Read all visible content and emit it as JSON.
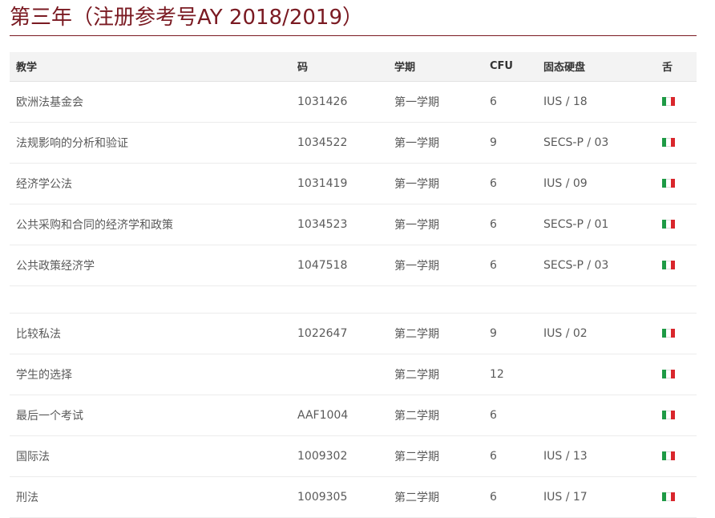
{
  "page": {
    "title": "第三年（注册参考号AY 2018/2019）"
  },
  "table": {
    "headers": {
      "course": "教学",
      "code": "码",
      "semester": "学期",
      "cfu": "CFU",
      "ssd": "固态硬盘",
      "language": "舌"
    },
    "semester1_rows": [
      {
        "course": "欧洲法基金会",
        "code": "1031426",
        "semester": "第一学期",
        "cfu": "6",
        "ssd": "IUS / 18",
        "language_icon": "italy-flag-icon"
      },
      {
        "course": "法规影响的分析和验证",
        "code": "1034522",
        "semester": "第一学期",
        "cfu": "9",
        "ssd": "SECS-P / 03",
        "language_icon": "italy-flag-icon"
      },
      {
        "course": "经济学公法",
        "code": "1031419",
        "semester": "第一学期",
        "cfu": "6",
        "ssd": "IUS / 09",
        "language_icon": "italy-flag-icon"
      },
      {
        "course": "公共采购和合同的经济学和政策",
        "code": "1034523",
        "semester": "第一学期",
        "cfu": "6",
        "ssd": "SECS-P / 01",
        "language_icon": "italy-flag-icon"
      },
      {
        "course": "公共政策经济学",
        "code": "1047518",
        "semester": "第一学期",
        "cfu": "6",
        "ssd": "SECS-P / 03",
        "language_icon": "italy-flag-icon"
      }
    ],
    "semester2_rows": [
      {
        "course": "比较私法",
        "code": "1022647",
        "semester": "第二学期",
        "cfu": "9",
        "ssd": "IUS / 02",
        "language_icon": "italy-flag-icon"
      },
      {
        "course": "学生的选择",
        "code": "",
        "semester": "第二学期",
        "cfu": "12",
        "ssd": "",
        "language_icon": "italy-flag-icon"
      },
      {
        "course": "最后一个考试",
        "code": "AAF1004",
        "semester": "第二学期",
        "cfu": "6",
        "ssd": "",
        "language_icon": "italy-flag-icon"
      },
      {
        "course": "国际法",
        "code": "1009302",
        "semester": "第二学期",
        "cfu": "6",
        "ssd": "IUS / 13",
        "language_icon": "italy-flag-icon"
      },
      {
        "course": "刑法",
        "code": "1009305",
        "semester": "第二学期",
        "cfu": "6",
        "ssd": "IUS / 17",
        "language_icon": "italy-flag-icon"
      }
    ]
  },
  "colors": {
    "accent": "#7a1a22",
    "header_bg": "#f3f3f3",
    "flag_green": "#1e9a45",
    "flag_red": "#d9262c"
  }
}
